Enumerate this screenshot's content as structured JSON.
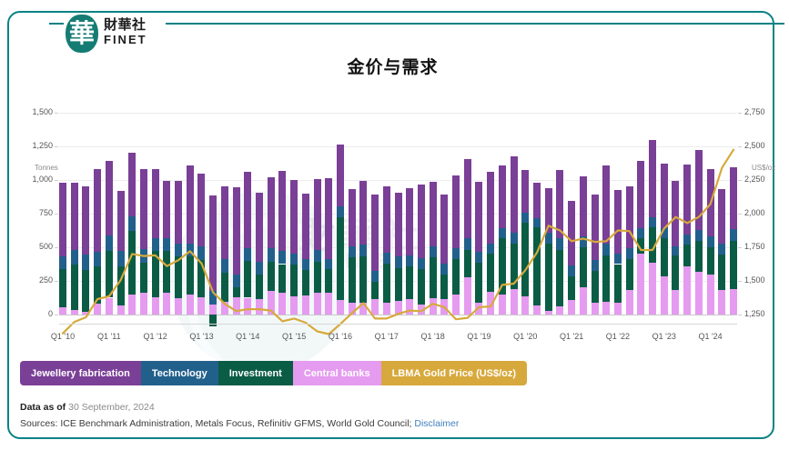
{
  "brand": {
    "mark_glyph": "華",
    "name_cn": "財華社",
    "name_en": "FINET"
  },
  "header": {
    "title": "金价与需求"
  },
  "watermark": {
    "text_primary": "財華社",
    "text_secondary": "FINET"
  },
  "legend": {
    "items": [
      {
        "label": "Jewellery fabrication",
        "color": "#7a3f96"
      },
      {
        "label": "Technology",
        "color": "#22608c"
      },
      {
        "label": "Investment",
        "color": "#0b5c45"
      },
      {
        "label": "Central banks",
        "color": "#e59bf0"
      },
      {
        "label": "LBMA Gold Price (US$/oz)",
        "color": "#d7a93c"
      }
    ]
  },
  "footer": {
    "data_as_of_label": "Data as of",
    "data_as_of_value": "30 September, 2024",
    "sources_text": "Sources: ICE Benchmark Administration, Metals Focus, Refinitiv GFMS, World Gold Council;",
    "disclaimer_label": "Disclaimer"
  },
  "chart_data": {
    "type": "bar",
    "title": "金价与需求",
    "subtitle": "",
    "xlabel": "",
    "ylabel": "Tonnes",
    "y2label": "US$/oz",
    "ylim": [
      0,
      1500
    ],
    "y2lim": [
      1250,
      2750
    ],
    "yticks": [
      "0",
      "250",
      "500",
      "750",
      "1,000",
      "1,250",
      "1,500"
    ],
    "ytick_values": [
      0,
      250,
      500,
      750,
      1000,
      1250,
      1500
    ],
    "y2ticks": [
      "1,250",
      "1,500",
      "1,750",
      "2,000",
      "2,250",
      "2,500",
      "2,750"
    ],
    "y2tick_values": [
      1250,
      1500,
      1750,
      2000,
      2250,
      2500,
      2750
    ],
    "grid": true,
    "legend_position": "bottom-left",
    "xtick_labels": [
      "Q1 '10",
      "Q1 '11",
      "Q1 '12",
      "Q1 '13",
      "Q1 '14",
      "Q1 '15",
      "Q1 '16",
      "Q1 '17",
      "Q1 '18",
      "Q1 '19",
      "Q1 '20",
      "Q1 '21",
      "Q1 '22",
      "Q1 '23",
      "Q1 '24"
    ],
    "xtick_indices": [
      0,
      4,
      8,
      12,
      16,
      20,
      24,
      28,
      32,
      36,
      40,
      44,
      48,
      52,
      56
    ],
    "categories": [
      "Q1 '10",
      "Q2 '10",
      "Q3 '10",
      "Q4 '10",
      "Q1 '11",
      "Q2 '11",
      "Q3 '11",
      "Q4 '11",
      "Q1 '12",
      "Q2 '12",
      "Q3 '12",
      "Q4 '12",
      "Q1 '13",
      "Q2 '13",
      "Q3 '13",
      "Q4 '13",
      "Q1 '14",
      "Q2 '14",
      "Q3 '14",
      "Q4 '14",
      "Q1 '15",
      "Q2 '15",
      "Q3 '15",
      "Q4 '15",
      "Q1 '16",
      "Q2 '16",
      "Q3 '16",
      "Q4 '16",
      "Q1 '17",
      "Q2 '17",
      "Q3 '17",
      "Q4 '17",
      "Q1 '18",
      "Q2 '18",
      "Q3 '18",
      "Q4 '18",
      "Q1 '19",
      "Q2 '19",
      "Q3 '19",
      "Q4 '19",
      "Q1 '20",
      "Q2 '20",
      "Q3 '20",
      "Q4 '20",
      "Q1 '21",
      "Q2 '21",
      "Q3 '21",
      "Q4 '21",
      "Q1 '22",
      "Q2 '22",
      "Q3 '22",
      "Q4 '22",
      "Q1 '23",
      "Q2 '23",
      "Q3 '23",
      "Q4 '23",
      "Q1 '24",
      "Q2 '24",
      "Q3 '24"
    ],
    "series": [
      {
        "name": "Central banks",
        "color": "#e59bf0",
        "values": [
          55,
          35,
          20,
          80,
          125,
          65,
          150,
          160,
          130,
          165,
          120,
          150,
          130,
          75,
          95,
          130,
          125,
          115,
          175,
          165,
          135,
          140,
          165,
          165,
          105,
          85,
          90,
          115,
          90,
          100,
          115,
          75,
          120,
          115,
          150,
          275,
          90,
          170,
          150,
          190,
          135,
          65,
          30,
          60,
          110,
          205,
          90,
          95,
          85,
          185,
          450,
          385,
          285,
          185,
          360,
          320,
          300,
          185,
          190
        ]
      },
      {
        "name": "Investment",
        "color": "#0b5c45",
        "values": [
          280,
          335,
          310,
          275,
          350,
          295,
          470,
          225,
          340,
          305,
          310,
          285,
          275,
          -85,
          215,
          70,
          275,
          180,
          215,
          210,
          235,
          190,
          230,
          170,
          620,
          340,
          345,
          125,
          290,
          245,
          240,
          260,
          305,
          180,
          260,
          205,
          295,
          280,
          415,
          340,
          550,
          585,
          495,
          420,
          175,
          295,
          235,
          345,
          290,
          225,
          115,
          265,
          285,
          255,
          160,
          230,
          200,
          260,
          360
        ]
      },
      {
        "name": "Technology",
        "color": "#22608c",
        "values": [
          100,
          110,
          115,
          110,
          110,
          110,
          110,
          100,
          100,
          100,
          100,
          95,
          100,
          100,
          100,
          100,
          95,
          100,
          100,
          95,
          85,
          85,
          85,
          80,
          80,
          80,
          85,
          85,
          80,
          85,
          85,
          85,
          80,
          85,
          85,
          85,
          80,
          80,
          80,
          75,
          70,
          65,
          80,
          85,
          80,
          80,
          80,
          85,
          80,
          80,
          75,
          70,
          70,
          70,
          75,
          80,
          80,
          80,
          85
        ]
      },
      {
        "name": "Jewellery fabrication",
        "color": "#7a3f96",
        "values": [
          545,
          500,
          505,
          615,
          560,
          450,
          470,
          595,
          510,
          425,
          465,
          575,
          540,
          710,
          545,
          645,
          565,
          510,
          530,
          595,
          545,
          485,
          525,
          600,
          460,
          425,
          475,
          565,
          490,
          475,
          500,
          545,
          480,
          510,
          540,
          590,
          520,
          530,
          460,
          570,
          320,
          265,
          335,
          510,
          480,
          450,
          490,
          580,
          470,
          465,
          500,
          580,
          480,
          480,
          520,
          595,
          500,
          410,
          460
        ]
      }
    ],
    "line_series": {
      "name": "LBMA Gold Price (US$/oz)",
      "color": "#d7a93c",
      "axis": "right",
      "values": [
        1110,
        1195,
        1230,
        1365,
        1385,
        1505,
        1700,
        1685,
        1690,
        1610,
        1655,
        1720,
        1630,
        1415,
        1330,
        1275,
        1290,
        1290,
        1280,
        1200,
        1220,
        1190,
        1125,
        1105,
        1180,
        1260,
        1335,
        1220,
        1220,
        1255,
        1280,
        1275,
        1330,
        1305,
        1215,
        1225,
        1305,
        1310,
        1470,
        1480,
        1580,
        1710,
        1910,
        1875,
        1795,
        1815,
        1790,
        1795,
        1875,
        1870,
        1730,
        1730,
        1890,
        1975,
        1930,
        1975,
        2070,
        2340,
        2475
      ]
    }
  }
}
